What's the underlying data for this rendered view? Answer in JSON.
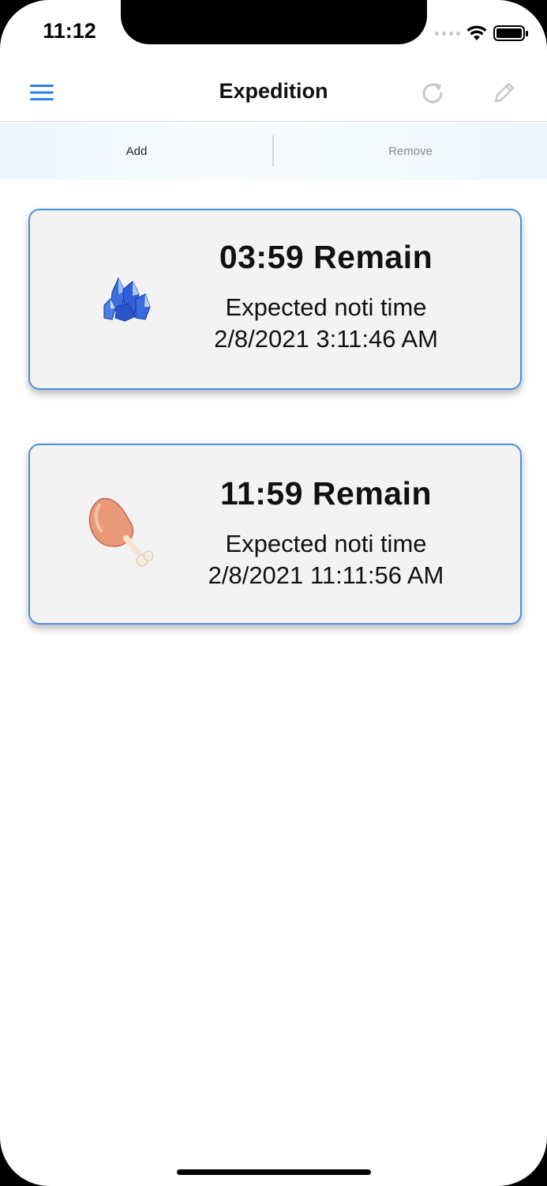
{
  "status_bar": {
    "time": "11:12"
  },
  "nav": {
    "title": "Expedition"
  },
  "segments": {
    "add_label": "Add",
    "remove_label": "Remove"
  },
  "cards": [
    {
      "icon": "crystal-icon",
      "remain": "03:59 Remain",
      "label": "Expected noti time",
      "time": "2/8/2021 3:11:46 AM"
    },
    {
      "icon": "drumstick-icon",
      "remain": "11:59 Remain",
      "label": "Expected noti time",
      "time": "2/8/2021 11:11:56 AM"
    }
  ],
  "colors": {
    "accent": "#4a90e2",
    "card_bg": "#f3f3f3",
    "icon_inactive": "#c7c7cc"
  }
}
